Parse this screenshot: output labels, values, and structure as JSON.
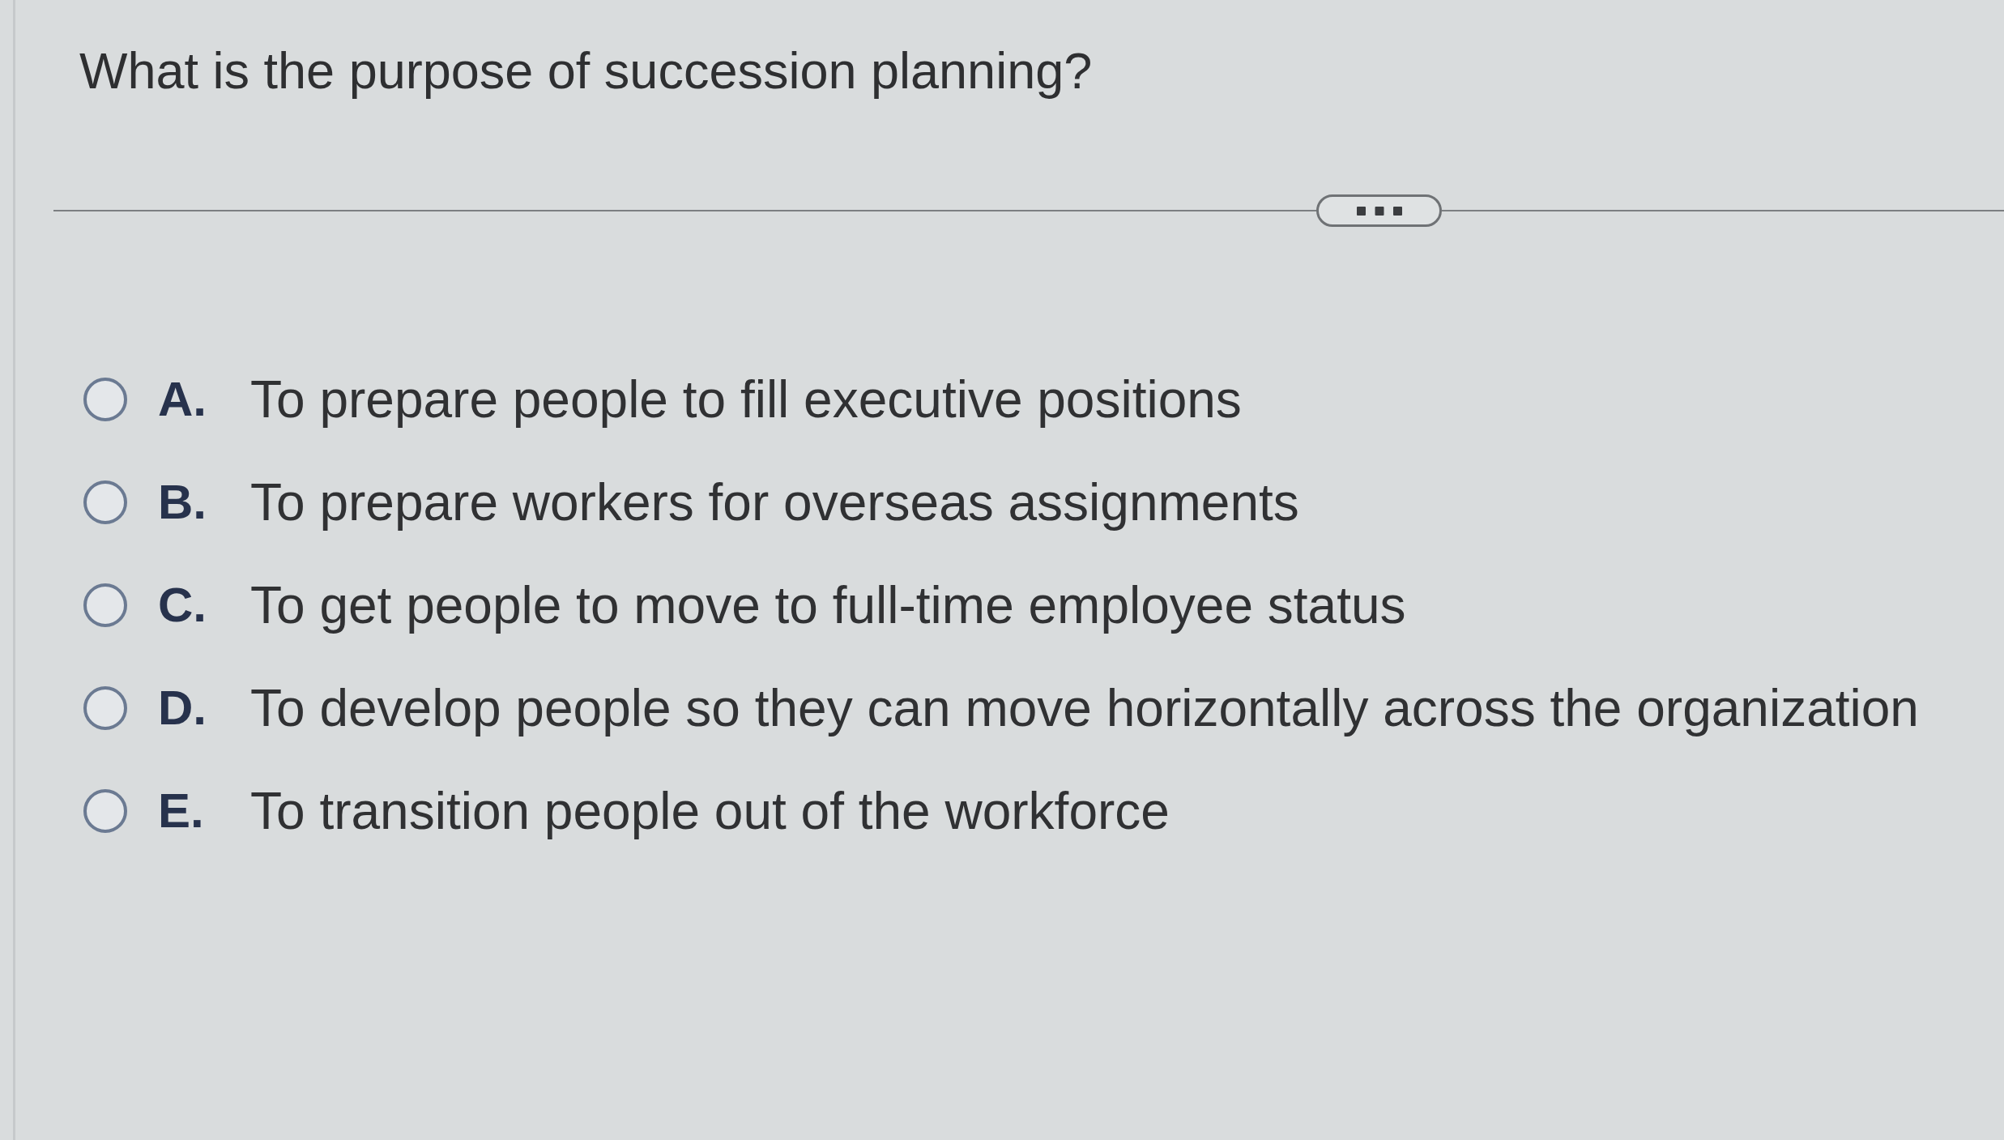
{
  "question": "What is the purpose of succession planning?",
  "options": [
    {
      "letter": "A.",
      "text": "To prepare people to fill executive positions",
      "selected": false
    },
    {
      "letter": "B.",
      "text": "To prepare workers for overseas assignments",
      "selected": false
    },
    {
      "letter": "C.",
      "text": "To get people to move to full-time employee status",
      "selected": false
    },
    {
      "letter": "D.",
      "text": "To develop people so they can move horizontally across the organization",
      "selected": false
    },
    {
      "letter": "E.",
      "text": "To transition people out of the workforce",
      "selected": false
    }
  ]
}
